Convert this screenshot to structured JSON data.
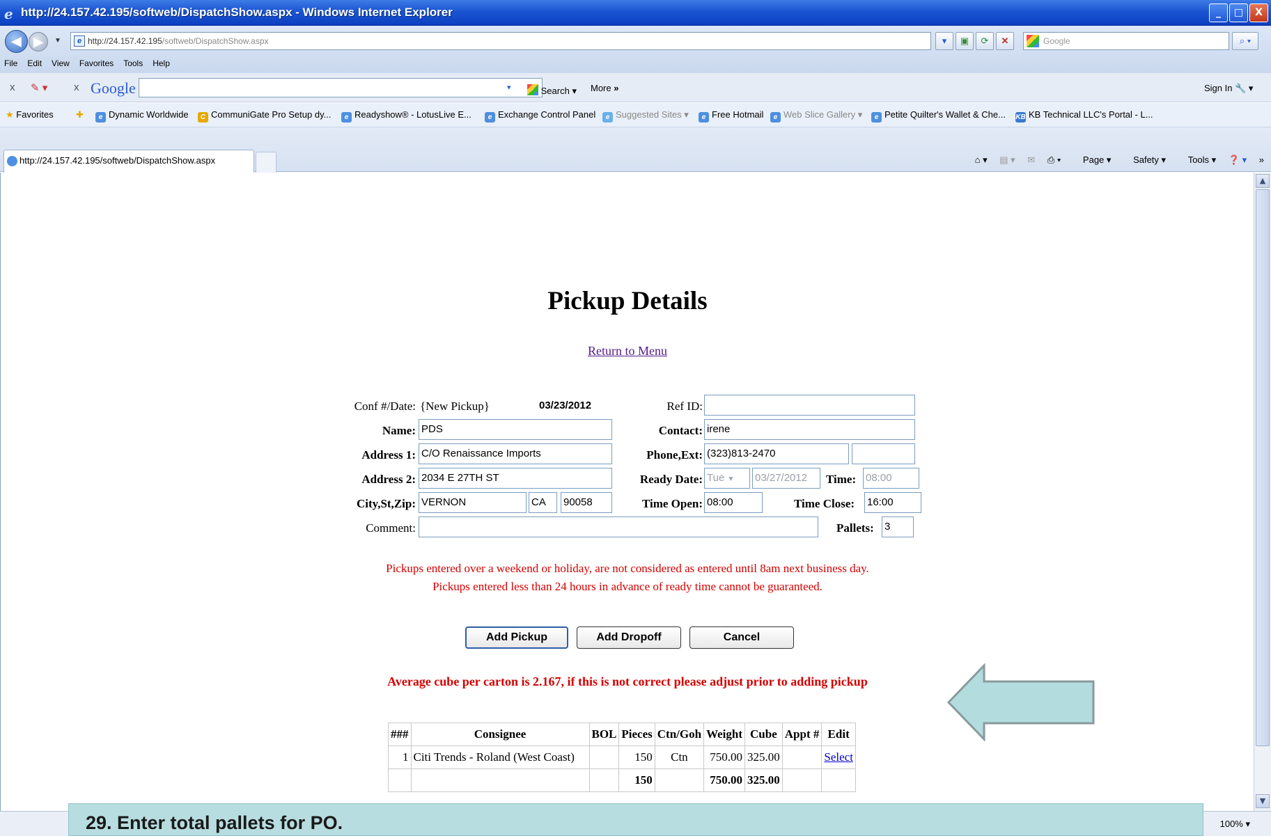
{
  "window": {
    "title": "http://24.157.42.195/softweb/DispatchShow.aspx - Windows Internet Explorer",
    "minimize": "_",
    "maximize": "□",
    "close": "X"
  },
  "address_bar": {
    "url_host": "http://24.157.42.195",
    "url_path": "/softweb/DispatchShow.aspx",
    "search_placeholder": "Google"
  },
  "menu": [
    "File",
    "Edit",
    "View",
    "Favorites",
    "Tools",
    "Help"
  ],
  "google_toolbar": {
    "logo": "Google",
    "search_label": "Search",
    "more_label": "More",
    "sign_in": "Sign In"
  },
  "favorites_bar": {
    "favorites_label": "Favorites",
    "items": [
      "Dynamic Worldwide",
      "CommuniGate Pro Setup dy...",
      "Readyshow® - LotusLive E...",
      "Exchange Control Panel",
      "Suggested Sites",
      "Free Hotmail",
      "Web Slice Gallery",
      "Petite Quilter's Wallet & Che...",
      "KB Technical LLC's Portal - L..."
    ]
  },
  "tab": {
    "title": "http://24.157.42.195/softweb/DispatchShow.aspx"
  },
  "command_bar": {
    "page": "Page",
    "safety": "Safety",
    "tools": "Tools"
  },
  "page": {
    "title": "Pickup Details",
    "return_link": "Return to Menu",
    "labels": {
      "conf": "Conf #/Date:",
      "name": "Name:",
      "address1": "Address 1:",
      "address2": "Address 2:",
      "city": "City,St,Zip:",
      "comment": "Comment:",
      "ref": "Ref ID:",
      "contact": "Contact:",
      "phone": "Phone,Ext:",
      "ready_date": "Ready Date:",
      "time": "Time:",
      "time_open": "Time Open:",
      "time_close": "Time Close:",
      "pallets": "Pallets:"
    },
    "values": {
      "conf": "{New Pickup}",
      "date": "03/23/2012",
      "name": "PDS",
      "address1": "C/O Renaissance Imports",
      "address2": "2034 E 27TH ST",
      "city": "VERNON",
      "state": "CA",
      "zip": "90058",
      "comment": "",
      "ref": "",
      "contact": "irene",
      "phone": "(323)813-2470",
      "ext": "",
      "ready_day": "Tue",
      "ready_date": "03/27/2012",
      "time": "08:00",
      "time_open": "08:00",
      "time_close": "16:00",
      "pallets": "3"
    },
    "notice_1": "Pickups entered over a weekend or holiday, are not considered as entered until 8am next business day.",
    "notice_2": "Pickups entered less than 24 hours in advance of ready time cannot be guaranteed.",
    "buttons": {
      "add_pickup": "Add Pickup",
      "add_dropoff": "Add Dropoff",
      "cancel": "Cancel"
    },
    "warning": "Average cube per carton is 2.167, if this is not correct please adjust prior to adding pickup",
    "table": {
      "headers": [
        "###",
        "Consignee",
        "BOL",
        "Pieces",
        "Ctn/Goh",
        "Weight",
        "Cube",
        "Appt #",
        "Edit"
      ],
      "rows": [
        [
          "1",
          "Citi Trends - Roland (West Coast)",
          "",
          "150",
          "Ctn",
          "750.00",
          "325.00",
          "",
          "Select"
        ]
      ],
      "totals": [
        "",
        "",
        "",
        "150",
        "",
        "750.00",
        "325.00",
        "",
        ""
      ]
    }
  },
  "status_bar": {
    "zoom": "100%"
  },
  "caption": "29.  Enter total pallets for PO.",
  "colors": {
    "accent_arrow": "#b3dcdf",
    "notice_red": "#d50000",
    "caption_bg": "#b7dde0"
  }
}
